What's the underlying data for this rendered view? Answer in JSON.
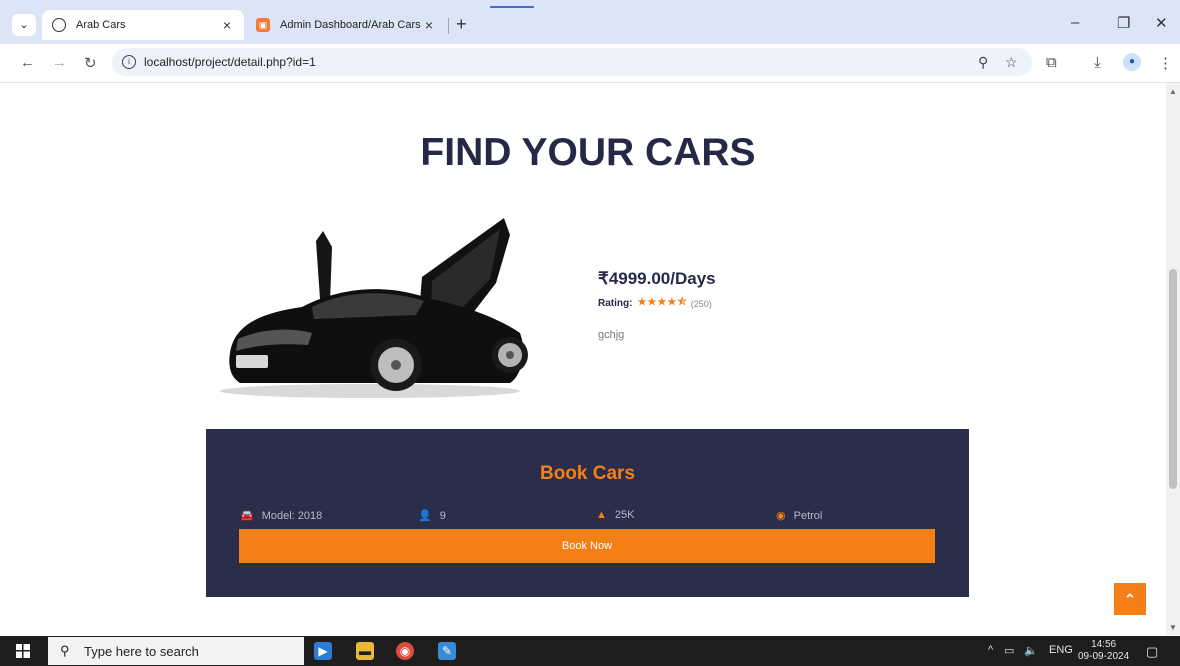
{
  "browser": {
    "tabs": [
      {
        "title": "Arab Cars"
      },
      {
        "title": "Admin Dashboard/Arab Cars"
      }
    ],
    "url": "localhost/project/detail.php?id=1"
  },
  "page": {
    "heading": "FIND YOUR CARS",
    "price": "₹4999.00/Days",
    "rating_label": "Rating:",
    "rating_value": 4.5,
    "rating_count": "(250)",
    "description": "gchjg",
    "book": {
      "title": "Book Cars",
      "specs": {
        "model": "Model: 2018",
        "seats": "9",
        "mileage": "25K",
        "fuel": "Petrol"
      },
      "button": "Book Now"
    }
  },
  "taskbar": {
    "search_placeholder": "Type here to search",
    "language": "ENG",
    "time": "14:56",
    "date": "09-09-2024"
  },
  "colors": {
    "accent": "#f57f17",
    "navy": "#2b2e4a",
    "heading": "#252846"
  }
}
